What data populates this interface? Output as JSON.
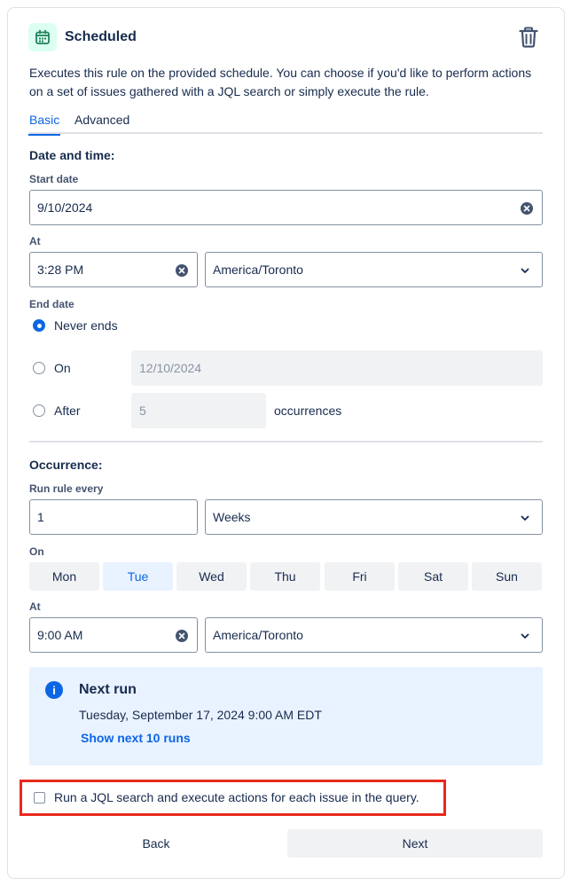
{
  "header": {
    "title": "Scheduled",
    "description": "Executes this rule on the provided schedule. You can choose if you'd like to perform actions on a set of issues gathered with a JQL search or simply execute the rule."
  },
  "tabs": [
    {
      "label": "Basic",
      "active": true
    },
    {
      "label": "Advanced",
      "active": false
    }
  ],
  "date_time": {
    "heading": "Date and time:",
    "start_date_label": "Start date",
    "start_date_value": "9/10/2024",
    "at_label": "At",
    "time_value": "3:28 PM",
    "timezone_value": "America/Toronto"
  },
  "end_date": {
    "label": "End date",
    "never_label": "Never ends",
    "on_label": "On",
    "on_value": "12/10/2024",
    "after_label": "After",
    "after_value": "5",
    "occurrences_label": "occurrences",
    "selected": "never"
  },
  "occurrence": {
    "heading": "Occurrence:",
    "run_every_label": "Run rule every",
    "interval_value": "1",
    "unit_value": "Weeks",
    "on_label": "On",
    "days": [
      {
        "label": "Mon",
        "selected": false
      },
      {
        "label": "Tue",
        "selected": true
      },
      {
        "label": "Wed",
        "selected": false
      },
      {
        "label": "Thu",
        "selected": false
      },
      {
        "label": "Fri",
        "selected": false
      },
      {
        "label": "Sat",
        "selected": false
      },
      {
        "label": "Sun",
        "selected": false
      }
    ],
    "at_label": "At",
    "time_value": "9:00 AM",
    "timezone_value": "America/Toronto"
  },
  "next_run": {
    "title": "Next run",
    "value": "Tuesday, September 17, 2024 9:00 AM EDT",
    "link": "Show next 10 runs",
    "icon_glyph": "i"
  },
  "jql": {
    "label": "Run a JQL search and execute actions for each issue in the query.",
    "checked": false
  },
  "footer": {
    "back_label": "Back",
    "next_label": "Next"
  },
  "colors": {
    "accent": "#0c66e4",
    "highlight_border": "#e8291b",
    "info_bg": "#e9f2ff",
    "icon_bg": "#dcfff1",
    "icon_fg": "#1f845a"
  },
  "icons": {
    "trigger": "calendar-icon",
    "delete": "trash-icon",
    "clear": "clear-icon",
    "dropdown": "chevron-down-icon",
    "info": "info-icon"
  }
}
